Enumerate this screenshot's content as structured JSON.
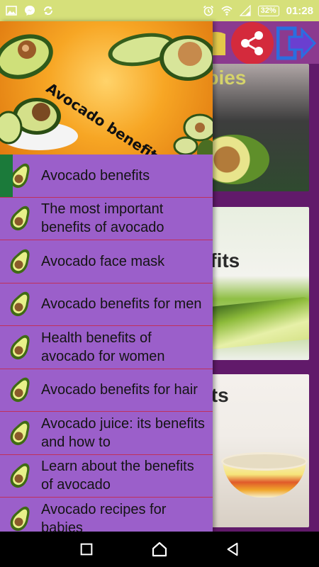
{
  "status_bar": {
    "battery": "32%",
    "time": "01:28",
    "left_icons": [
      "image-icon",
      "messenger-icon",
      "sync-icon"
    ],
    "right_icons": [
      "alarm-icon",
      "wifi-icon",
      "signal-icon",
      "battery-icon"
    ]
  },
  "background": {
    "cards": [
      {
        "title": "r babies"
      },
      {
        "title": "enefits"
      },
      {
        "title": "ffects"
      }
    ]
  },
  "drawer": {
    "header_title": "Avocado benefits",
    "items": [
      {
        "label": "Avocado benefits",
        "active": true
      },
      {
        "label": "The most important benefits of avocado"
      },
      {
        "label": "Avocado face mask"
      },
      {
        "label": "Avocado benefits for men"
      },
      {
        "label": "Health benefits of avocado for women"
      },
      {
        "label": "Avocado benefits for hair"
      },
      {
        "label": "Avocado juice: its benefits and how to"
      },
      {
        "label": "Learn about the benefits of avocado"
      },
      {
        "label": "Avocado recipes for babies"
      }
    ]
  },
  "colors": {
    "status_bar": "#d6e07a",
    "drawer_bg": "#9b5fca",
    "active_indicator": "#1b7a3a",
    "divider": "#c0305a",
    "share_button": "#d42a3c"
  }
}
